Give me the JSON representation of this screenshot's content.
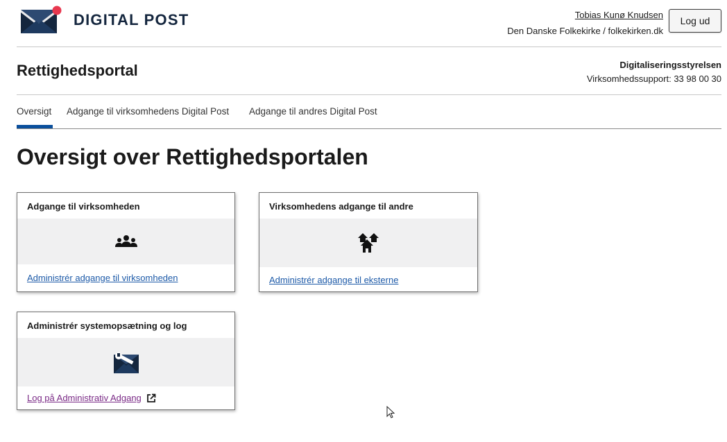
{
  "header": {
    "logo_text": "DIGITAL POST",
    "user_name": "Tobias Kunø Knudsen",
    "organization": "Den Danske Folkekirke / folkekirken.dk",
    "logout_label": "Log ud"
  },
  "portal": {
    "title": "Rettighedsportal",
    "agency_name": "Digitaliseringsstyrelsen",
    "support": "Virksomhedssupport: 33 98 00 30"
  },
  "tabs": [
    {
      "label": "Oversigt",
      "active": true
    },
    {
      "label": "Adgange til virksomhedens Digital Post",
      "active": false
    },
    {
      "label": "Adgange til andres Digital Post",
      "active": false
    }
  ],
  "page": {
    "title": "Oversigt over Rettighedsportalen"
  },
  "cards": [
    {
      "title": "Adgange til virksomheden",
      "icon": "users-icon",
      "link": "Administrér adgange til virksomheden"
    },
    {
      "title": "Virksomhedens adgange til andre",
      "icon": "houses-icon",
      "link": "Administrér adgange til eksterne"
    },
    {
      "title": "Administrér systemopsætning og log",
      "icon": "admin-envelope-wrench-icon",
      "link": "Log på Administrativ Adgang",
      "external_icon": "external-link-icon"
    }
  ],
  "colors": {
    "brand_navy": "#14263e",
    "brand_accent": "#e8384f",
    "active_tab": "#0b4f9c",
    "link": "#1d5aa8",
    "visited_link": "#7a2a86"
  }
}
